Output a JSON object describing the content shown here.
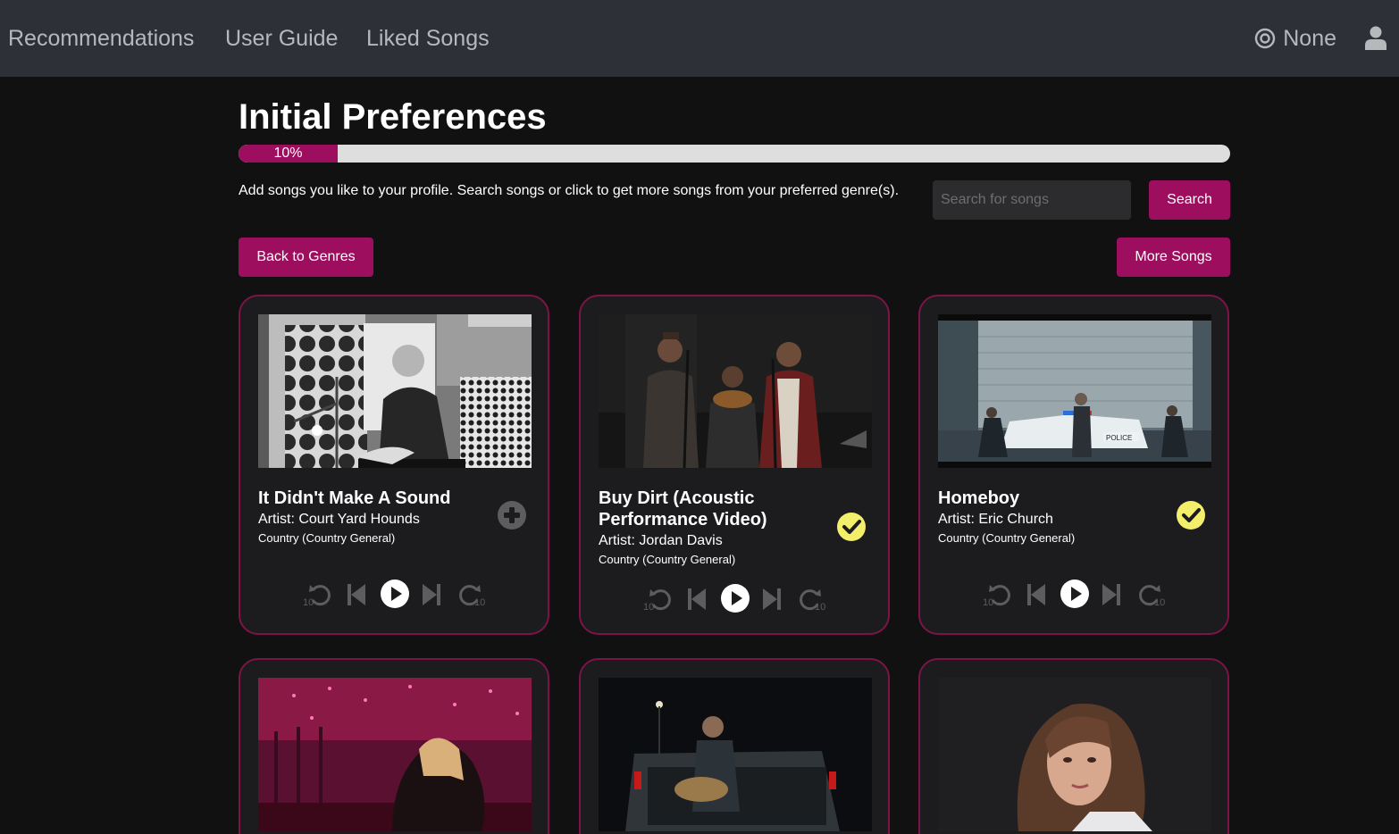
{
  "nav": {
    "links": [
      "Recommendations",
      "User Guide",
      "Liked Songs"
    ],
    "status_label": "None",
    "status_icon": "target-icon",
    "user_icon": "user-icon"
  },
  "page": {
    "title": "Initial Preferences",
    "progress_value": 0.1,
    "progress_label": "10%",
    "instructions": "Add songs you like to your profile. Search songs or click to get more songs from your preferred genre(s).",
    "search_placeholder": "Search for songs",
    "search_button": "Search",
    "back_button": "Back to Genres",
    "more_button": "More Songs"
  },
  "colors": {
    "accent": "#9d0f5e",
    "card_border": "#7c1448",
    "liked": "#f3ef6b"
  },
  "controls": {
    "skip_seconds": "10"
  },
  "songs": [
    {
      "title": "It Didn't Make A Sound",
      "artist": "Artist: Court Yard Hounds",
      "genre": "Country (Country General)",
      "status": "add"
    },
    {
      "title": "Buy Dirt (Acoustic Performance Video)",
      "artist": "Artist: Jordan Davis",
      "genre": "Country (Country General)",
      "status": "liked"
    },
    {
      "title": "Homeboy",
      "artist": "Artist: Eric Church",
      "genre": "Country (Country General)",
      "status": "liked"
    }
  ]
}
